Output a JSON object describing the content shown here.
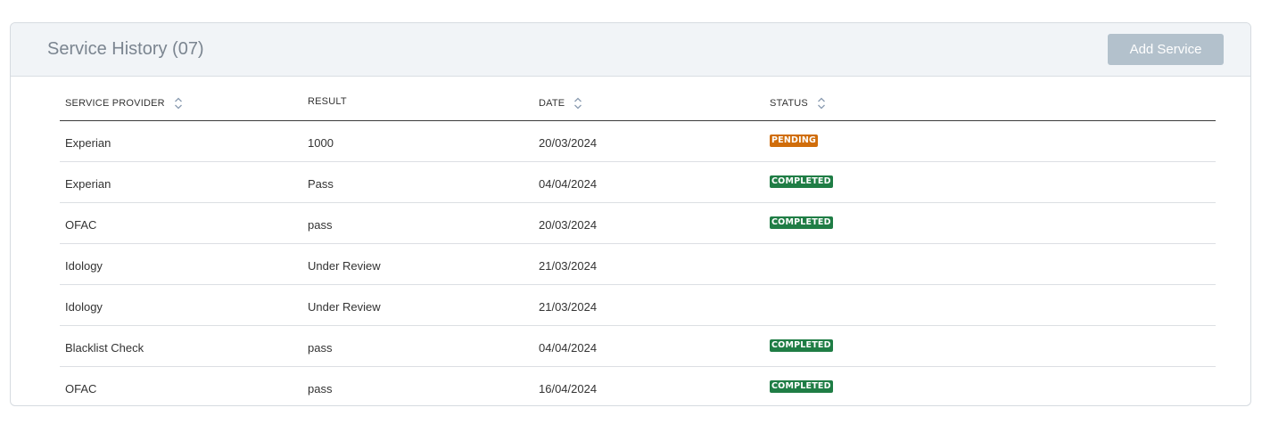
{
  "panel": {
    "title": "Service History (07)",
    "add_button_label": "Add Service"
  },
  "table": {
    "columns": [
      {
        "label": "SERVICE PROVIDER",
        "sortable": true
      },
      {
        "label": "RESULT",
        "sortable": false
      },
      {
        "label": "DATE",
        "sortable": true
      },
      {
        "label": "STATUS",
        "sortable": true
      }
    ],
    "rows": [
      {
        "provider": "Experian",
        "result": "1000",
        "date": "20/03/2024",
        "status": "PENDING"
      },
      {
        "provider": "Experian",
        "result": "Pass",
        "date": "04/04/2024",
        "status": "COMPLETED"
      },
      {
        "provider": "OFAC",
        "result": "pass",
        "date": "20/03/2024",
        "status": "COMPLETED"
      },
      {
        "provider": "Idology",
        "result": "Under Review",
        "date": "21/03/2024",
        "status": ""
      },
      {
        "provider": "Idology",
        "result": "Under Review",
        "date": "21/03/2024",
        "status": ""
      },
      {
        "provider": "Blacklist Check",
        "result": "pass",
        "date": "04/04/2024",
        "status": "COMPLETED"
      },
      {
        "provider": "OFAC",
        "result": "pass",
        "date": "16/04/2024",
        "status": "COMPLETED"
      }
    ]
  },
  "status_colors": {
    "PENDING": "#d06d0a",
    "COMPLETED": "#1f7d45"
  },
  "icons": {
    "sort": "sort-icon"
  }
}
